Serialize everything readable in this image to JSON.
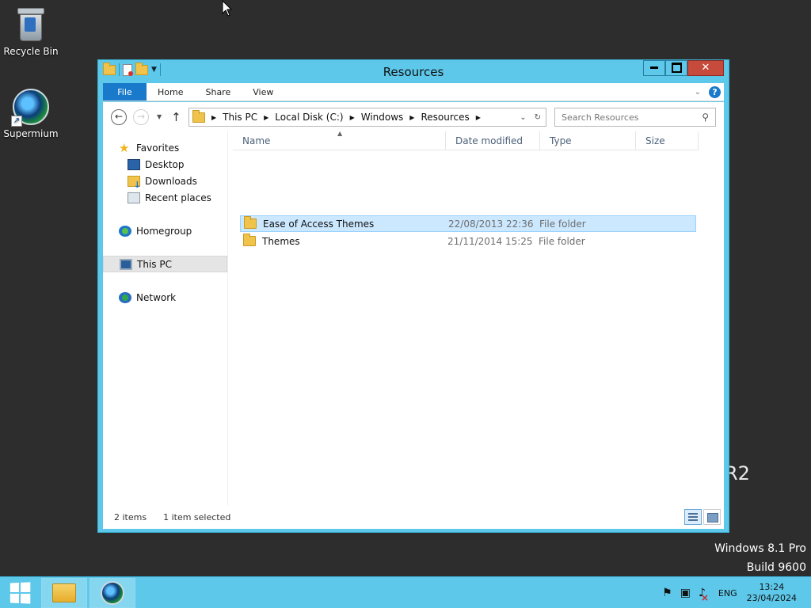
{
  "desktop": {
    "icons": [
      {
        "label": "Recycle Bin",
        "icon": "recycle-bin-icon"
      },
      {
        "label": "Supermium",
        "icon": "supermium-icon"
      }
    ],
    "watermark_partial": "R2",
    "watermark_line1": "Windows 8.1 Pro",
    "watermark_line2": "Build 9600"
  },
  "window": {
    "title": "Resources",
    "ribbon_tabs": [
      "File",
      "Home",
      "Share",
      "View"
    ],
    "help": "?",
    "breadcrumb": [
      "This PC",
      "Local Disk (C:)",
      "Windows",
      "Resources"
    ],
    "search_placeholder": "Search Resources",
    "nav_pane": {
      "favorites": "Favorites",
      "favorites_items": [
        "Desktop",
        "Downloads",
        "Recent places"
      ],
      "homegroup": "Homegroup",
      "this_pc": "This PC",
      "network": "Network",
      "selected": "This PC"
    },
    "columns": [
      "Name",
      "Date modified",
      "Type",
      "Size"
    ],
    "files": [
      {
        "name": "Ease of Access Themes",
        "date": "22/08/2013 22:36",
        "type": "File folder",
        "size": "",
        "selected": true
      },
      {
        "name": "Themes",
        "date": "21/11/2014 15:25",
        "type": "File folder",
        "size": "",
        "selected": false
      }
    ],
    "status": {
      "count": "2 items",
      "selection": "1 item selected"
    },
    "view_mode": "details"
  },
  "taskbar": {
    "pinned": [
      "file-explorer",
      "supermium"
    ],
    "language": "ENG",
    "time": "13:24",
    "date": "23/04/2024",
    "accent": "#5dc8ea"
  }
}
